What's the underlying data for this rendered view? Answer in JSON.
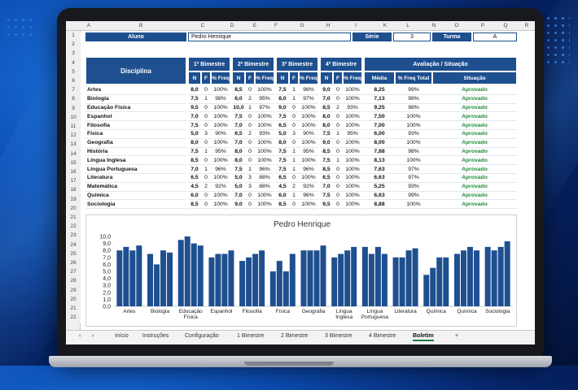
{
  "columns": [
    "A",
    "B",
    "C",
    "D",
    "E",
    "F",
    "G",
    "H",
    "I",
    "K",
    "L",
    "N",
    "O",
    "P",
    "Q",
    "R"
  ],
  "row_numbers": [
    "1",
    "2",
    "3",
    "4",
    "5",
    "6",
    "7",
    "8",
    "9",
    "10",
    "11",
    "12",
    "13",
    "14",
    "15",
    "16",
    "17",
    "18",
    "19",
    "20",
    "21",
    "22",
    "23",
    "24",
    "25",
    "26",
    "27",
    "28",
    "29",
    "20",
    "21",
    "22"
  ],
  "header": {
    "aluno_label": "Aluno",
    "aluno_value": "Pedro Henrique",
    "serie_label": "Série",
    "serie_value": "3",
    "turma_label": "Turma",
    "turma_value": "A"
  },
  "table_headers": {
    "disciplina": "Disciplina",
    "b1": "1º Bimestre",
    "b2": "2º Bimestre",
    "b3": "3º Bimestre",
    "b4": "4º Bimestre",
    "avaliacao": "Avaliação / Situação",
    "n": "N",
    "f": "F",
    "freq": "% Freq",
    "media": "Média",
    "freq_total": "% Freq Total",
    "situacao": "Situação"
  },
  "rows": [
    [
      "Artes",
      "8,0",
      "0",
      "100%",
      "8,5",
      "0",
      "100%",
      "7,5",
      "1",
      "98%",
      "9,0",
      "0",
      "100%",
      "8,25",
      "99%",
      "Aprovado"
    ],
    [
      "Biologia",
      "7,5",
      "1",
      "98%",
      "6,0",
      "2",
      "95%",
      "8,0",
      "1",
      "97%",
      "7,0",
      "0",
      "100%",
      "7,13",
      "98%",
      "Aprovado"
    ],
    [
      "Educação Física",
      "9,5",
      "0",
      "100%",
      "10,0",
      "1",
      "97%",
      "9,0",
      "0",
      "100%",
      "8,5",
      "2",
      "93%",
      "9,25",
      "98%",
      "Aprovado"
    ],
    [
      "Espanhol",
      "7,0",
      "0",
      "100%",
      "7,5",
      "0",
      "100%",
      "7,5",
      "0",
      "100%",
      "8,0",
      "0",
      "100%",
      "7,50",
      "100%",
      "Aprovado"
    ],
    [
      "Filosofia",
      "7,5",
      "0",
      "100%",
      "7,0",
      "0",
      "100%",
      "6,5",
      "0",
      "100%",
      "8,0",
      "0",
      "100%",
      "7,00",
      "100%",
      "Aprovado"
    ],
    [
      "Física",
      "5,0",
      "3",
      "90%",
      "6,5",
      "2",
      "93%",
      "5,0",
      "3",
      "90%",
      "7,5",
      "1",
      "95%",
      "6,00",
      "93%",
      "Aprovado"
    ],
    [
      "Geografia",
      "8,0",
      "0",
      "100%",
      "7,0",
      "0",
      "100%",
      "8,0",
      "0",
      "100%",
      "9,0",
      "0",
      "100%",
      "8,00",
      "100%",
      "Aprovado"
    ],
    [
      "História",
      "7,5",
      "1",
      "95%",
      "8,0",
      "0",
      "100%",
      "7,5",
      "1",
      "95%",
      "8,5",
      "0",
      "100%",
      "7,88",
      "98%",
      "Aprovado"
    ],
    [
      "Língua Inglesa",
      "8,5",
      "0",
      "100%",
      "8,0",
      "0",
      "100%",
      "7,5",
      "1",
      "100%",
      "7,5",
      "1",
      "100%",
      "8,13",
      "100%",
      "Aprovado"
    ],
    [
      "Língua Portuguesa",
      "7,0",
      "1",
      "96%",
      "7,5",
      "1",
      "96%",
      "7,5",
      "1",
      "96%",
      "8,5",
      "0",
      "100%",
      "7,63",
      "97%",
      "Aprovado"
    ],
    [
      "Literatura",
      "6,5",
      "0",
      "100%",
      "5,0",
      "3",
      "88%",
      "6,5",
      "0",
      "100%",
      "6,5",
      "0",
      "100%",
      "6,63",
      "97%",
      "Aprovado"
    ],
    [
      "Matemática",
      "4,5",
      "2",
      "92%",
      "5,0",
      "3",
      "88%",
      "4,5",
      "2",
      "92%",
      "7,0",
      "0",
      "100%",
      "5,25",
      "93%",
      "Aprovado"
    ],
    [
      "Química",
      "6,0",
      "0",
      "100%",
      "7,0",
      "0",
      "100%",
      "6,0",
      "1",
      "96%",
      "7,5",
      "0",
      "100%",
      "6,63",
      "99%",
      "Aprovado"
    ],
    [
      "Sociologia",
      "8,5",
      "0",
      "100%",
      "9,0",
      "0",
      "100%",
      "8,5",
      "0",
      "100%",
      "9,5",
      "0",
      "100%",
      "8,88",
      "100%",
      "Aprovado"
    ]
  ],
  "colors": {
    "header_blue": "#1e4f8f",
    "approved_green": "#1e8a3c",
    "bar_blue": "#1e4f8f"
  },
  "chart_data": {
    "type": "bar",
    "title": "Pedro Henrique",
    "categories": [
      "Artes",
      "Biologia",
      "Educação Física",
      "Espanhol",
      "Filosofia",
      "Física",
      "Geografia",
      "Língua Inglesa",
      "Língua Portuguesa",
      "Literatura",
      "Química",
      "Química",
      "Sociologia"
    ],
    "category_lines": [
      [
        "Artes"
      ],
      [
        "Biologia"
      ],
      [
        "Educação",
        "Física"
      ],
      [
        "Espanhol"
      ],
      [
        "Filosofia"
      ],
      [
        "Física"
      ],
      [
        "Geografia"
      ],
      [
        "Língua",
        "Inglesa"
      ],
      [
        "Língua",
        "Portuguesa"
      ],
      [
        "Literatura"
      ],
      [
        "Química"
      ],
      [
        "Química"
      ],
      [
        "Sociologia"
      ]
    ],
    "series": [
      {
        "values": [
          8.0,
          7.5,
          9.5,
          7.0,
          6.5,
          5.0,
          8.0,
          7.0,
          8.5,
          7.0,
          4.5,
          7.5,
          8.5
        ]
      },
      {
        "values": [
          8.5,
          6.0,
          10.0,
          7.5,
          7.0,
          6.5,
          8.0,
          7.5,
          7.5,
          7.0,
          5.5,
          8.0,
          8.0
        ]
      },
      {
        "values": [
          8.0,
          8.0,
          9.0,
          7.5,
          7.5,
          5.0,
          8.0,
          8.0,
          8.5,
          8.0,
          7.0,
          8.5,
          8.5
        ]
      },
      {
        "values": [
          8.7,
          7.7,
          8.7,
          8.0,
          8.0,
          7.5,
          8.7,
          8.5,
          7.5,
          8.3,
          7.0,
          8.0,
          9.3
        ]
      }
    ],
    "ytick_labels": [
      "10,0",
      "9,0",
      "8,0",
      "7,0",
      "6,0",
      "5,0",
      "4,0",
      "3,0",
      "2,0",
      "1,0",
      "0,0"
    ],
    "ylim": [
      0,
      10
    ],
    "grid": false,
    "legend": "none"
  },
  "tabs": [
    "Início",
    "Instruções",
    "Configuração",
    "1 Bimestre",
    "2 Bimestre",
    "3 Bimestre",
    "4 Bimestre",
    "Boletim",
    "+"
  ],
  "active_tab": "Boletim"
}
